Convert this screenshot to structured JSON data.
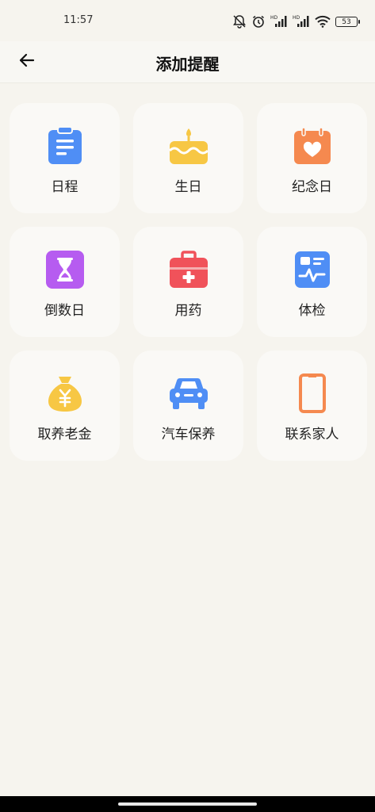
{
  "status_bar": {
    "time": "11:57",
    "battery": "53",
    "icons": [
      "mute-bell-icon",
      "alarm-icon",
      "signal-hd-icon",
      "signal-hd-icon",
      "wifi-icon",
      "battery-icon"
    ]
  },
  "header": {
    "title": "添加提醒",
    "back_icon": "back-arrow-icon"
  },
  "items": [
    {
      "label": "日程",
      "icon": "schedule-clipboard-icon",
      "color": "#4f8ef5"
    },
    {
      "label": "生日",
      "icon": "birthday-cake-icon",
      "color": "#f7c744"
    },
    {
      "label": "纪念日",
      "icon": "calendar-heart-icon",
      "color": "#f5894f"
    },
    {
      "label": "倒数日",
      "icon": "hourglass-icon",
      "color": "#b65cf0"
    },
    {
      "label": "用药",
      "icon": "medicine-kit-icon",
      "color": "#f0525a"
    },
    {
      "label": "体检",
      "icon": "health-check-icon",
      "color": "#4f8ef5"
    },
    {
      "label": "取养老金",
      "icon": "money-bag-icon",
      "color": "#f7c744"
    },
    {
      "label": "汽车保养",
      "icon": "car-icon",
      "color": "#4f8ef5"
    },
    {
      "label": "联系家人",
      "icon": "phone-icon",
      "color": "#f5894f"
    }
  ]
}
